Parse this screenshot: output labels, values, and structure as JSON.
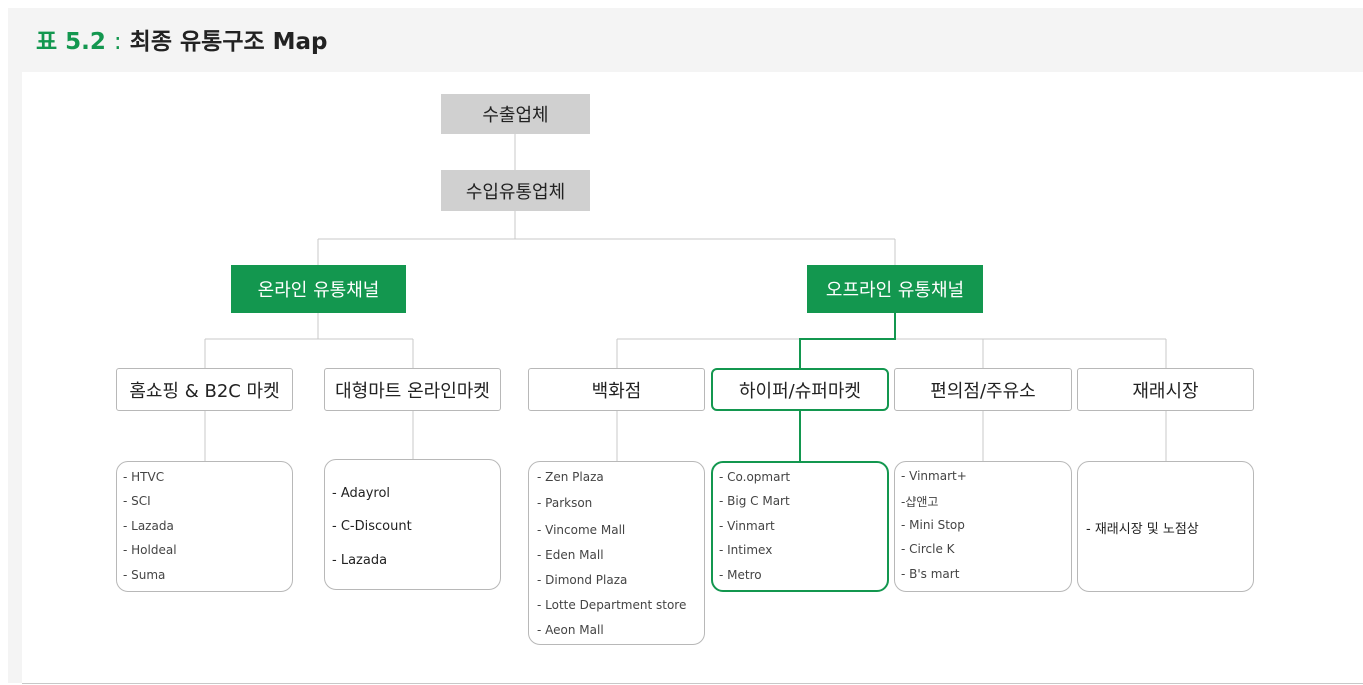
{
  "title": {
    "label": "표 5.2",
    "separator": ":",
    "text": "최종 유통구조 Map"
  },
  "colors": {
    "green": "#13974f",
    "gray_box": "#d0d0d0",
    "line": "#c8c8c8"
  },
  "nodes": {
    "exporter": "수출업체",
    "importer": "수입유통업체",
    "online": "온라인 유통채널",
    "offline": "오프라인 유통채널"
  },
  "categories": {
    "homeshopping": "홈쇼핑 & B2C 마켓",
    "mart_online": "대형마트 온라인마켓",
    "department": "백화점",
    "hypermarket": "하이퍼/슈퍼마켓",
    "convenience": "편의점/주유소",
    "traditional": "재래시장"
  },
  "lists": {
    "homeshopping": [
      "- HTVC",
      "- SCI",
      "- Lazada",
      "- Holdeal",
      "- Suma"
    ],
    "mart_online": [
      "- Adayrol",
      "- C-Discount",
      "- Lazada"
    ],
    "department": [
      "- Zen Plaza",
      "- Parkson",
      "- Vincome Mall",
      "- Eden Mall",
      "- Dimond Plaza",
      "- Lotte Department store",
      "- Aeon Mall"
    ],
    "hypermarket": [
      "- Co.opmart",
      "- Big C Mart",
      "- Vinmart",
      "- Intimex",
      "- Metro"
    ],
    "convenience": [
      "- Vinmart+",
      "-샵앤고",
      "- Mini Stop",
      "- Circle K",
      "- B's mart"
    ],
    "traditional": [
      "- 재래시장 및 노점상"
    ]
  }
}
